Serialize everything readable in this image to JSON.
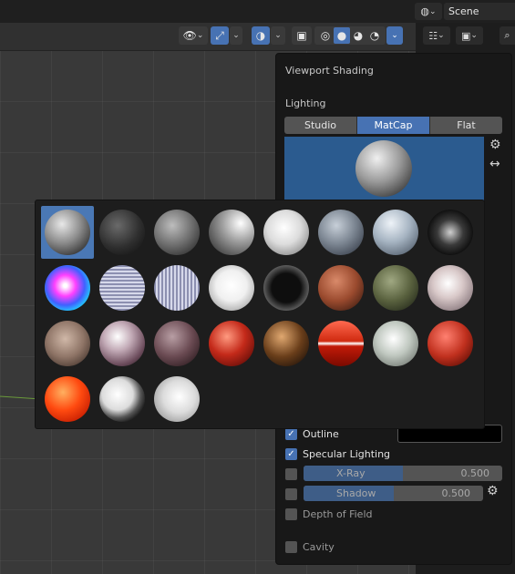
{
  "topbar": {
    "scene_label": "Scene"
  },
  "shading": {
    "title": "Viewport Shading",
    "lighting_label": "Lighting",
    "lighting_tabs": [
      {
        "label": "Studio",
        "active": false
      },
      {
        "label": "MatCap",
        "active": true
      },
      {
        "label": "Flat",
        "active": false
      }
    ],
    "outline": {
      "label": "Outline",
      "checked": true,
      "color": "#000000"
    },
    "specular": {
      "label": "Specular Lighting",
      "checked": true
    },
    "xray": {
      "label": "X-Ray",
      "value": "0.500",
      "fraction": 0.5,
      "checked": false
    },
    "shadow": {
      "label": "Shadow",
      "value": "0.500",
      "fraction": 0.5,
      "checked": false
    },
    "dof": {
      "label": "Depth of Field",
      "checked": false
    },
    "cavity": {
      "label": "Cavity",
      "checked": false
    }
  },
  "matcaps": [
    {
      "name": "basic-1",
      "bg": "radial-gradient(circle at 38% 32%, #e8e8e8, #8c8c8c 45%, #3a3a3a 80%)",
      "selected": true
    },
    {
      "name": "basic-dark",
      "bg": "radial-gradient(circle at 40% 35%, #6a6a6a, #2e2e2e 55%, #141414 90%)"
    },
    {
      "name": "basic-2",
      "bg": "radial-gradient(circle at 40% 35%, #bdbdbd, #6d6d6d 50%, #2a2a2a 90%)"
    },
    {
      "name": "basic-side",
      "bg": "radial-gradient(circle at 70% 30%, #ffffff, #a0a0a0 40%, #4a4a4a 80%)"
    },
    {
      "name": "basic-check",
      "bg": "radial-gradient(circle at 45% 40%, #ffffff, #dcdcdc 45%, #8a8a8a 85%)"
    },
    {
      "name": "ceramic-dark",
      "bg": "radial-gradient(circle at 40% 35%, #c7cfd8, #7e8894 45%, #3d4450 85%)"
    },
    {
      "name": "ceramic-lightbulb",
      "bg": "radial-gradient(circle at 40% 30%, #eef3f8, #a6b4c2 45%, #5a6674 85%)"
    },
    {
      "name": "check-normal-y",
      "bg": "radial-gradient(circle at 50% 50%, #cfcfcf, #3a3a3a 40%, #111 70%, #6a6a6a 95%)"
    },
    {
      "name": "check-rim-dark",
      "bg": "radial-gradient(circle at 45% 45%, #ffffff 5%, #ff40ff 30%, #4060ff 55%, #20d0ff 75%, #40ff60 95%)"
    },
    {
      "name": "jade-stripes",
      "bg": "repeating-linear-gradient(0deg, #8c8fb0 0 2px, #d6d8ea 2px 4px)"
    },
    {
      "name": "vstripes",
      "bg": "repeating-linear-gradient(90deg, #8c8fb0 0 2px, #d6d8ea 2px 4px)"
    },
    {
      "name": "metal-anisotropic",
      "bg": "radial-gradient(circle at 50% 45%, #ffffff, #f0f0f0 45%, #9a9a9a 90%)"
    },
    {
      "name": "metal-carpaint",
      "bg": "radial-gradient(circle at 50% 50%, #0e0e0e 45%, #6a6a6a 75%, #cfcfcf 92%)"
    },
    {
      "name": "metal-lead",
      "bg": "radial-gradient(circle at 40% 35%, #d98a6a, #9a4a2e 50%, #3e1d12 90%)"
    },
    {
      "name": "metal-shiny",
      "bg": "radial-gradient(circle at 40% 35%, #a0a882, #59613e 50%, #23281a 90%)"
    },
    {
      "name": "orange-metallic",
      "bg": "radial-gradient(circle at 45% 40%, #ffffff, #d8c8c8 40%, #7a6a70 90%)"
    },
    {
      "name": "pearl",
      "bg": "radial-gradient(circle at 45% 40%, #d0b8a8, #8e7466 50%, #3e2f28 90%)"
    },
    {
      "name": "reflection-check",
      "bg": "radial-gradient(circle at 40% 35%, #ffffff, #c2aab6 35%, #6a4a5a 70%, #20181c 95%)"
    },
    {
      "name": "reflection-smooth",
      "bg": "radial-gradient(circle at 40% 35%, #b89ea4, #6a4a52 50%, #2a1a1e 90%)"
    },
    {
      "name": "red-wax",
      "bg": "radial-gradient(circle at 40% 35%, #ff9a80, #c42a1a 45%, #5a0a06 90%)"
    },
    {
      "name": "resin",
      "bg": "radial-gradient(circle at 40% 35%, #e0a870, #6a3e1a 50%, #1e120a 90%)"
    },
    {
      "name": "rim-red",
      "bg": "linear-gradient(180deg, #ff6a50 0%, #d02a10 45%, #ffffff 50%, #c21a08 56%, #7a0a00 100%)"
    },
    {
      "name": "silver",
      "bg": "radial-gradient(circle at 45% 40%, #ffffff, #c0c8c0 45%, #6a706a 90%)"
    },
    {
      "name": "skin",
      "bg": "radial-gradient(circle at 40% 35%, #ff8070, #c0301e 50%, #5a0c04 90%)"
    },
    {
      "name": "toon",
      "bg": "radial-gradient(circle at 40% 35%, #ffb060, #ff4a10 45%, #c21a00 85%)"
    },
    {
      "name": "toon-bw",
      "bg": "radial-gradient(circle at 40% 40%, #ffffff, #dcdcdc 40%, #555 60%, #0a0a0a 80%, #2a8ab0 97%)"
    },
    {
      "name": "zebra",
      "bg": "radial-gradient(circle at 55% 45%, #ffffff, #dcdcdc 45%, #a0a0a0 80%, #5a5a5a 95%)"
    }
  ]
}
